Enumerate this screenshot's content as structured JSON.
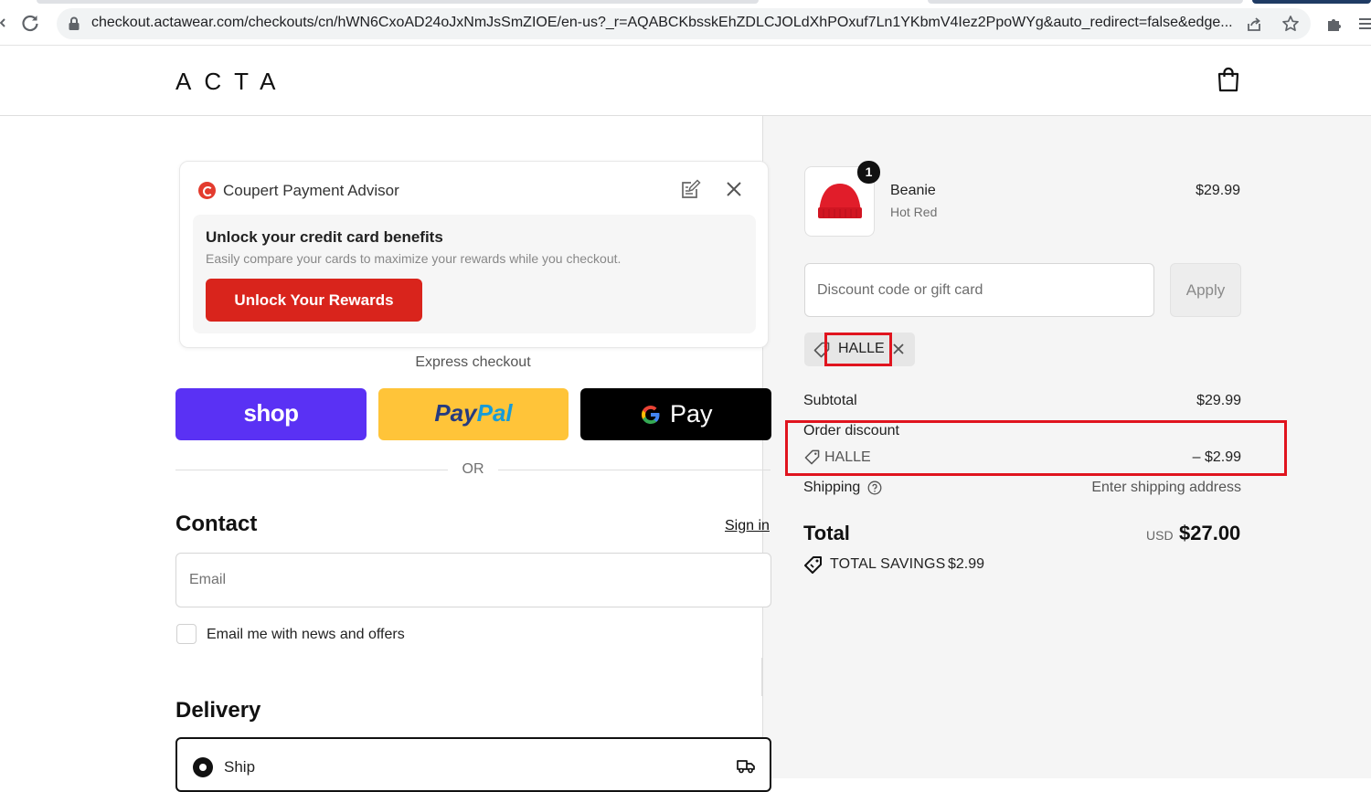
{
  "browser": {
    "url": "checkout.actawear.com/checkouts/cn/hWN6CxoAD24oJxNmJsSmZIOE/en-us?_r=AQABCKbsskEhZDLCJOLdXhPOxuf7Ln1YKbmV4Iez2PpoWYg&auto_redirect=false&edge..."
  },
  "header": {
    "logo": "ACTA"
  },
  "coupert": {
    "title": "Coupert Payment Advisor",
    "headline": "Unlock your credit card benefits",
    "subtext": "Easily compare your cards to maximize your rewards while you checkout.",
    "button_label": "Unlock Your Rewards",
    "brand_color": "#d9241c"
  },
  "express": {
    "label": "Express checkout",
    "shop_label": "shop",
    "paypal_label_1": "Pay",
    "paypal_label_2": "Pal",
    "gpay_g": "G",
    "gpay_label": " Pay",
    "or_label": "OR"
  },
  "contact": {
    "heading": "Contact",
    "signin_label": "Sign in",
    "email_placeholder": "Email",
    "news_label": "Email me with news and offers"
  },
  "delivery": {
    "heading": "Delivery",
    "ship_label": "Ship"
  },
  "summary": {
    "product": {
      "quantity": "1",
      "name": "Beanie",
      "variant": "Hot Red",
      "price": "$29.99"
    },
    "discount_placeholder": "Discount code or gift card",
    "apply_label": "Apply",
    "applied_code": "HALLE",
    "subtotal_label": "Subtotal",
    "subtotal_value": "$29.99",
    "order_discount_label": "Order discount",
    "order_discount_code": "HALLE",
    "order_discount_value": "– $2.99",
    "shipping_label": "Shipping",
    "shipping_value": "Enter shipping address",
    "total_label": "Total",
    "currency": "USD",
    "total_value": "$27.00",
    "savings_label": "TOTAL SAVINGS",
    "savings_value": "$2.99"
  },
  "colors": {
    "shop_purple": "#5a31f4",
    "paypal_yellow": "#ffc439",
    "highlight_red": "#e0141e",
    "beanie_red": "#e11d2a"
  }
}
